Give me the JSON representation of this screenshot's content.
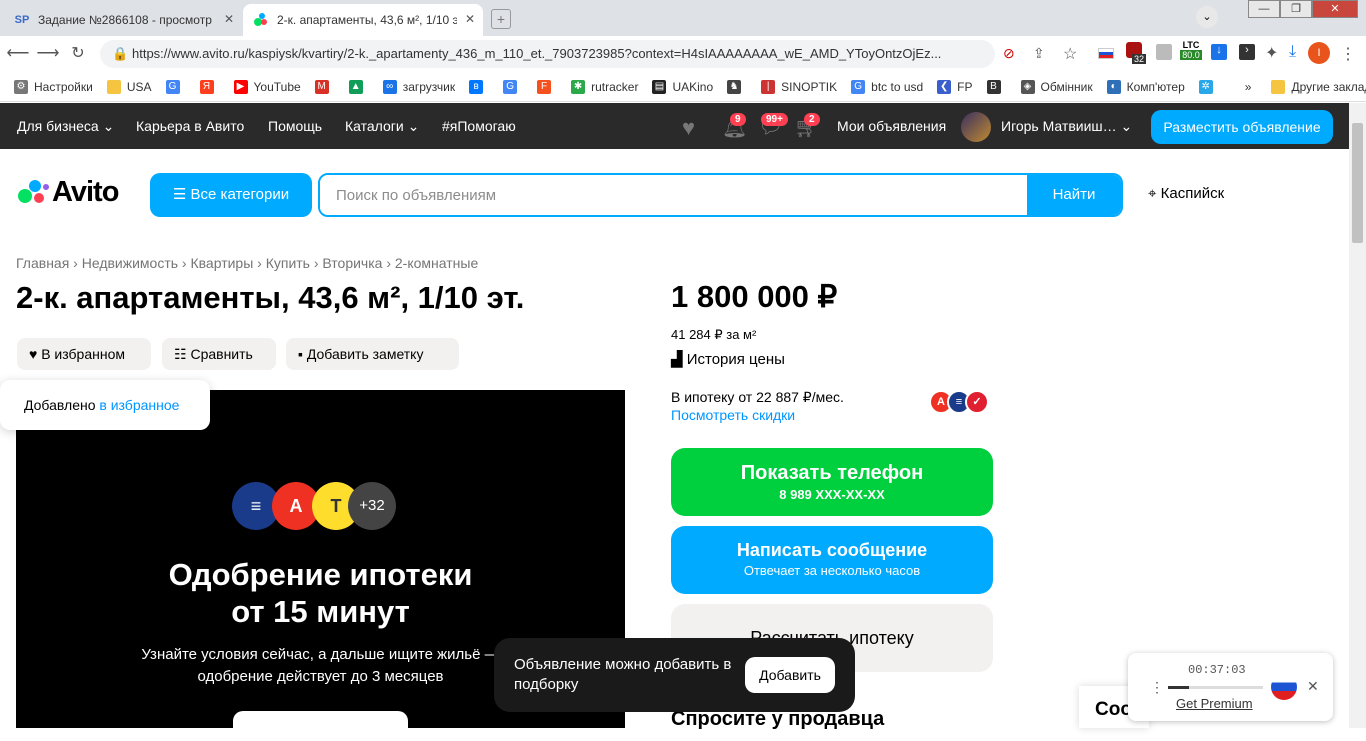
{
  "browser": {
    "tabs": [
      {
        "label": "Задание №2866108 - просмотр з",
        "favicon": "SP",
        "active": false
      },
      {
        "label": "2-к. апартаменты, 43,6 м², 1/10 эт",
        "favicon": "avito",
        "active": true
      }
    ],
    "url": "https://www.avito.ru/kaspiysk/kvartiry/2-k._apartamenty_436_m_110_et._7903723985?context=H4sIAAAAAAAA_wE_AMD_YToyOntzOjEz...",
    "ext_badge": "32",
    "ltc_label": "LTC",
    "ltc_value": "80.0",
    "profile_initial": "I",
    "bookmarks": [
      "Настройки",
      "USA",
      "",
      "",
      "YouTube",
      "",
      "",
      "загрузчик",
      "",
      "",
      "",
      "rutracker",
      "UAKino",
      "",
      "SINOPTIK",
      "btc to usd",
      "FP",
      "",
      "Обмінник",
      "Комп'ютер",
      ""
    ],
    "bookmarks_more": "»",
    "other_bookmarks": "Другие закладки"
  },
  "topnav": {
    "business": "Для бизнеса",
    "career": "Карьера в Авито",
    "help": "Помощь",
    "catalogs": "Каталоги",
    "ihelp": "#яПомогаю",
    "notif_badge": "9",
    "msg_badge": "99+",
    "cart_badge": "2",
    "my_ads": "Мои объявления",
    "user": "Игорь Матвииш…",
    "post_ad": "Разместить объявление"
  },
  "header": {
    "logo": "Avito",
    "all_categories": "Все категории",
    "search_placeholder": "Поиск по объявлениям",
    "search_button": "Найти",
    "city": "Каспийск"
  },
  "breadcrumbs": "Главная › Недвижимость › Квартиры › Купить › Вторичка › 2-комнатные",
  "listing": {
    "title": "2-к. апартаменты, 43,6 м², 1/10 эт.",
    "favorite": "В избранном",
    "compare": "Сравнить",
    "note": "Добавить заметку",
    "added_prefix": "Добавлено ",
    "added_link": "в избранное",
    "price": "1 800 000 ₽",
    "price_per_m": "41 284 ₽ за м²",
    "price_history": "История цены",
    "mortgage": "В ипотеку от 22 887 ₽/мес.",
    "discounts": "Посмотреть скидки",
    "show_phone": "Показать телефон",
    "phone_masked": "8 989 XXX-XX-XX",
    "write_msg": "Написать сообщение",
    "reply_time": "Отвечает за несколько часов",
    "calc_mortgage": "Рассчитать ипотеку",
    "ask_seller": "Спросите у продавца"
  },
  "banner": {
    "plus": "+32",
    "title_line1": "Одобрение ипотеки",
    "title_line2": "от 15 минут",
    "text_line1": "Узнайте условия сейчас, а дальше ищите жильё —",
    "text_line2": "одобрение действует до 3 месяцев"
  },
  "toast": {
    "text": "Объявление можно добавить в подборку",
    "button": "Добавить"
  },
  "chat_peek": "Соо",
  "player": {
    "time": "00:37:03",
    "premium": "Get Premium",
    "progress": 0.22
  }
}
